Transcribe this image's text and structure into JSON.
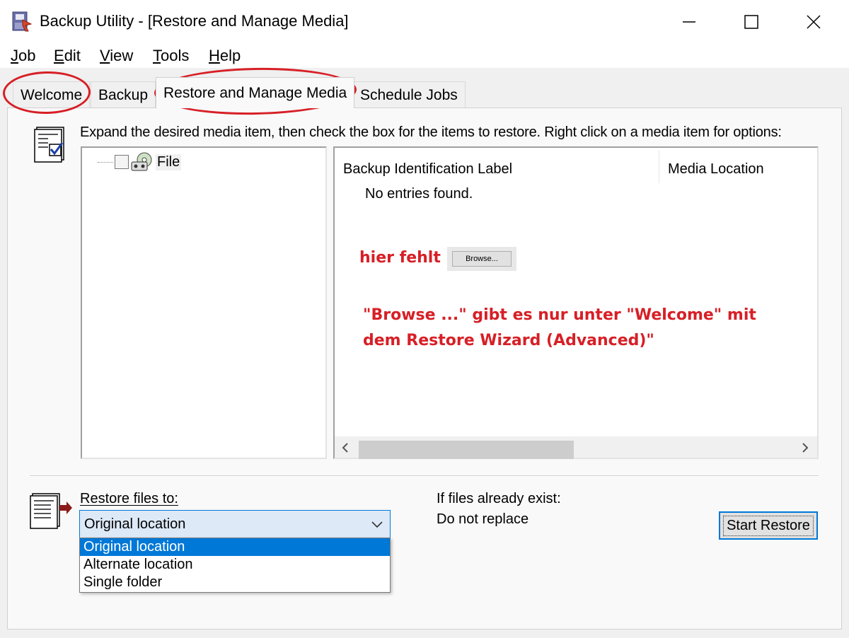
{
  "window": {
    "title": "Backup Utility - [Restore and Manage Media]"
  },
  "menu": {
    "items": [
      "Job",
      "Edit",
      "View",
      "Tools",
      "Help"
    ]
  },
  "tabs": {
    "items": [
      "Welcome",
      "Backup",
      "Restore and Manage Media",
      "Schedule Jobs"
    ],
    "active": "Restore and Manage Media"
  },
  "restore_tab": {
    "instruction": "Expand the desired media item, then check the box for the items to restore. Right click on a media item for options:",
    "tree": {
      "root_label": "File"
    },
    "list": {
      "columns": [
        "Backup Identification Label",
        "Media Location"
      ],
      "empty_text": "No entries found."
    },
    "restore_to": {
      "label": "Restore files to:",
      "selected": "Original location",
      "options": [
        "Original location",
        "Alternate location",
        "Single folder"
      ]
    },
    "if_exists": {
      "label": "If files already exist:",
      "value": "Do not replace"
    },
    "start_button": "Start Restore"
  },
  "annotation": {
    "missing_label": "hier fehlt",
    "browse_label": "Browse...",
    "note_line1": "\"Browse ...\" gibt es nur unter \"Welcome\" mit",
    "note_line2": "dem Restore Wizard (Advanced)\"",
    "color": "#d71f26"
  }
}
